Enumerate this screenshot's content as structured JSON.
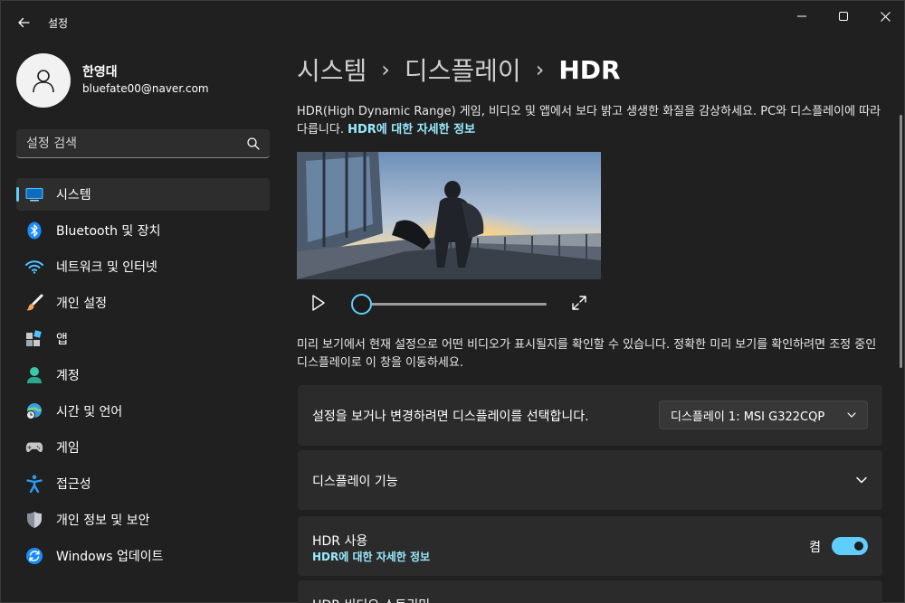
{
  "window": {
    "title": "설정",
    "back_icon": "arrow-left-icon",
    "minimize_glyph": "—",
    "close_glyph": "✕"
  },
  "profile": {
    "name": "한영대",
    "email": "bluefate00@naver.com"
  },
  "search": {
    "placeholder": "설정 검색"
  },
  "sidebar": {
    "items": [
      {
        "label": "시스템",
        "icon": "monitor-icon",
        "active": true
      },
      {
        "label": "Bluetooth 및 장치",
        "icon": "bluetooth-icon"
      },
      {
        "label": "네트워크 및 인터넷",
        "icon": "wifi-icon"
      },
      {
        "label": "개인 설정",
        "icon": "brush-icon"
      },
      {
        "label": "앱",
        "icon": "apps-icon"
      },
      {
        "label": "계정",
        "icon": "account-icon"
      },
      {
        "label": "시간 및 언어",
        "icon": "globe-clock-icon"
      },
      {
        "label": "게임",
        "icon": "gamepad-icon"
      },
      {
        "label": "접근성",
        "icon": "accessibility-icon"
      },
      {
        "label": "개인 정보 및 보안",
        "icon": "shield-icon"
      },
      {
        "label": "Windows 업데이트",
        "icon": "update-icon"
      }
    ]
  },
  "breadcrumb": {
    "parent1": "시스템",
    "parent2": "디스플레이",
    "current": "HDR",
    "separator": "›"
  },
  "main": {
    "intro_text": "HDR(High Dynamic Range) 게임, 비디오 및 앱에서 보다 밝고 생생한 화질을 감상하세요. PC와 디스플레이에 따라 다릅니다. ",
    "intro_link": "HDR에 대한 자세한 정보",
    "preview_text": "미리 보기에서 현재 설정으로 어떤 비디오가 표시될지를 확인할 수 있습니다. 정확한 미리 보기를 확인하려면 조정 중인 디스플레이로 이 창을 이동하세요.",
    "video_progress": 0,
    "display_select": {
      "label": "설정을 보거나 변경하려면 디스플레이를 선택합니다.",
      "value": "디스플레이 1: MSI G322CQP"
    },
    "display_features": {
      "label": "디스플레이 기능"
    },
    "hdr_use": {
      "label": "HDR 사용",
      "link": "HDR에 대한 자세한 정보",
      "state_label": "켬",
      "on": true
    },
    "hdr_streaming": {
      "label": "HDR 비디오 스트리밍"
    }
  },
  "colors": {
    "accent": "#60cdff",
    "link": "#99ebff",
    "background": "#202020",
    "card": "#2b2b2b"
  }
}
